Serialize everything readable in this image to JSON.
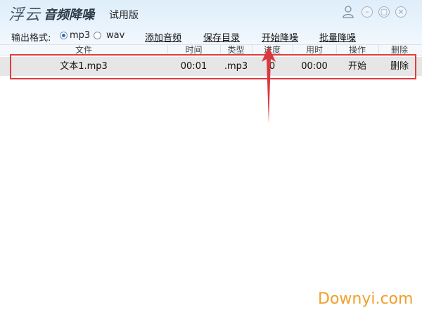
{
  "app": {
    "brand_fuyun": "浮云",
    "brand_name": "音频降噪",
    "edition": "试用版"
  },
  "window_controls": {
    "minimize_icon": "minimize-icon",
    "maximize_icon": "maximize-icon",
    "close_icon": "close-icon",
    "user_icon": "user-icon"
  },
  "toolbar": {
    "format_label": "输出格式:",
    "format_options": [
      "mp3",
      "wav"
    ],
    "selected_format": "mp3",
    "add_audio": "添加音频",
    "save_dir": "保存目录",
    "start_denoise": "开始降噪",
    "batch_denoise": "批量降噪"
  },
  "table": {
    "columns": [
      "文件",
      "时间",
      "类型",
      "进度",
      "用时",
      "操作",
      "删除"
    ],
    "rows": [
      {
        "file": "文本1.mp3",
        "time": "00:01",
        "type": ".mp3",
        "progress": "0",
        "elapsed": "00:00",
        "action": "开始",
        "delete": "删除"
      }
    ]
  },
  "annotation": {
    "highlight_color": "#e23c3c"
  },
  "watermark": "Downyi.com"
}
